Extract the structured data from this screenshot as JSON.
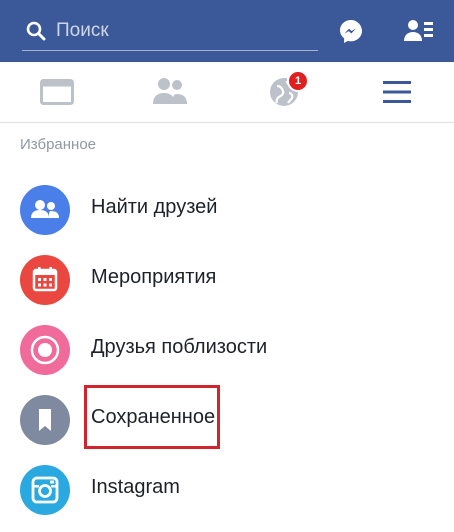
{
  "search": {
    "placeholder": "Поиск"
  },
  "tabs": {
    "notifications_badge": "1"
  },
  "section_title": "Избранное",
  "items": [
    {
      "label": "Найти друзей",
      "color": "#4a7ee8",
      "icon": "friends-icon"
    },
    {
      "label": "Мероприятия",
      "color": "#e9473f",
      "icon": "calendar-icon"
    },
    {
      "label": "Друзья поблизости",
      "color": "#f06a9a",
      "icon": "nearby-icon"
    },
    {
      "label": "Сохраненное",
      "color": "#7f8aa0",
      "icon": "bookmark-icon"
    },
    {
      "label": "Instagram",
      "color": "#2aa9e0",
      "icon": "instagram-icon"
    }
  ],
  "colors": {
    "brand": "#3b5998",
    "highlight": "#d0252d"
  }
}
